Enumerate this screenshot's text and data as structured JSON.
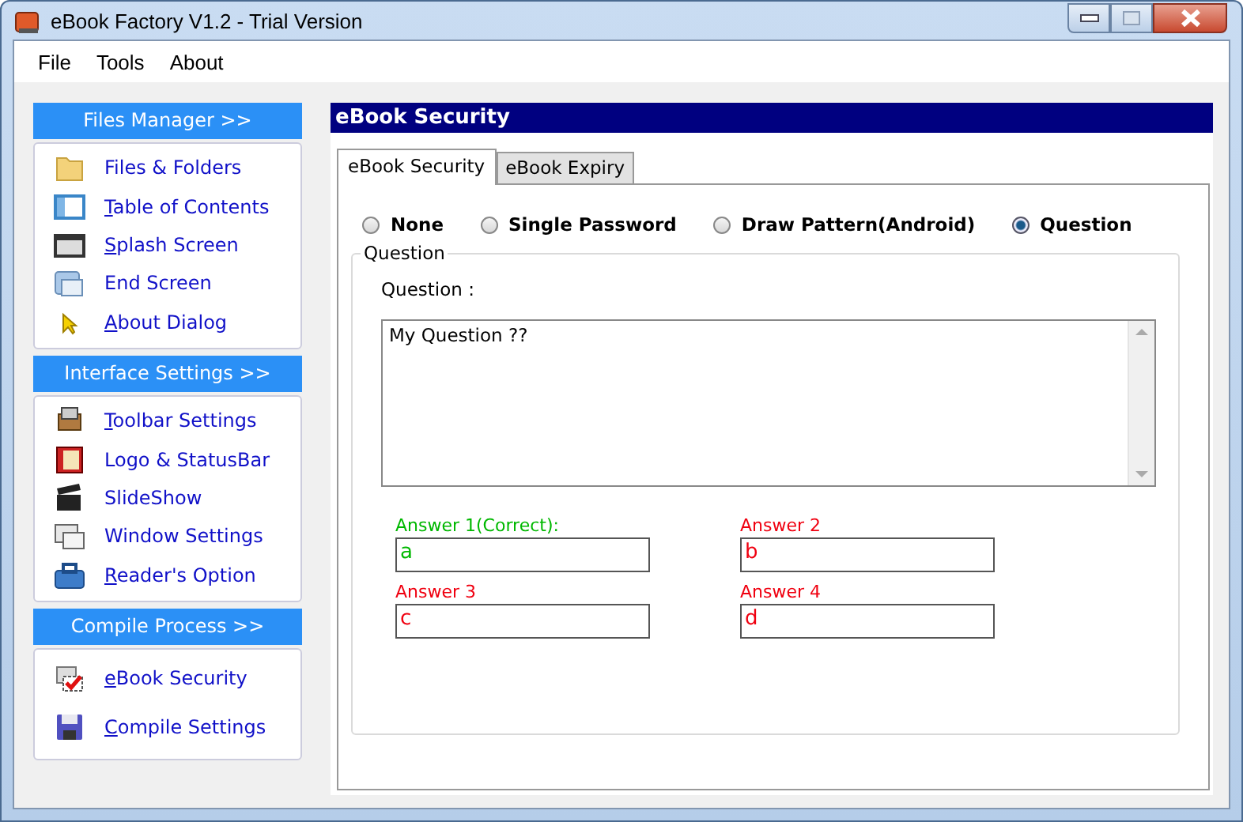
{
  "window": {
    "title": "eBook Factory  V1.2 - Trial Version"
  },
  "menu": [
    "File",
    "Tools",
    "About"
  ],
  "sidebar": {
    "groups": [
      {
        "title": "Files Manager >>",
        "items": [
          {
            "label": "Files & Folders",
            "mnemonic": false
          },
          {
            "label": "Table of Contents",
            "mnemonic": true
          },
          {
            "label": "Splash Screen",
            "mnemonic": true
          },
          {
            "label": "End Screen",
            "mnemonic": false
          },
          {
            "label": "About Dialog",
            "mnemonic": true
          }
        ]
      },
      {
        "title": "Interface Settings >>",
        "items": [
          {
            "label": "Toolbar Settings",
            "mnemonic": true
          },
          {
            "label": "Logo & StatusBar",
            "mnemonic": false
          },
          {
            "label": "SlideShow",
            "mnemonic": false
          },
          {
            "label": "Window Settings",
            "mnemonic": false
          },
          {
            "label": "Reader's Option",
            "mnemonic": true
          }
        ]
      },
      {
        "title": "Compile Process >>",
        "items": [
          {
            "label": "eBook Security",
            "mnemonic": true
          },
          {
            "label": "Compile Settings",
            "mnemonic": true
          }
        ]
      }
    ]
  },
  "panel": {
    "title": "eBook Security",
    "tabs": [
      {
        "label": "eBook Security",
        "selected": true
      },
      {
        "label": "eBook Expiry",
        "selected": false
      }
    ],
    "modes": [
      {
        "label": "None",
        "selected": false
      },
      {
        "label": "Single Password",
        "selected": false
      },
      {
        "label": "Draw Pattern(Android)",
        "selected": false
      },
      {
        "label": "Question",
        "selected": true
      }
    ],
    "group": {
      "title": "Question",
      "question_label": "Question :",
      "question": "My Question ??",
      "answers": [
        {
          "label": "Answer 1(Correct):",
          "value": "a",
          "correct": true
        },
        {
          "label": "Answer 2",
          "value": "b",
          "correct": false
        },
        {
          "label": "Answer 3",
          "value": "c",
          "correct": false
        },
        {
          "label": "Answer 4",
          "value": "d",
          "correct": false
        }
      ]
    }
  }
}
